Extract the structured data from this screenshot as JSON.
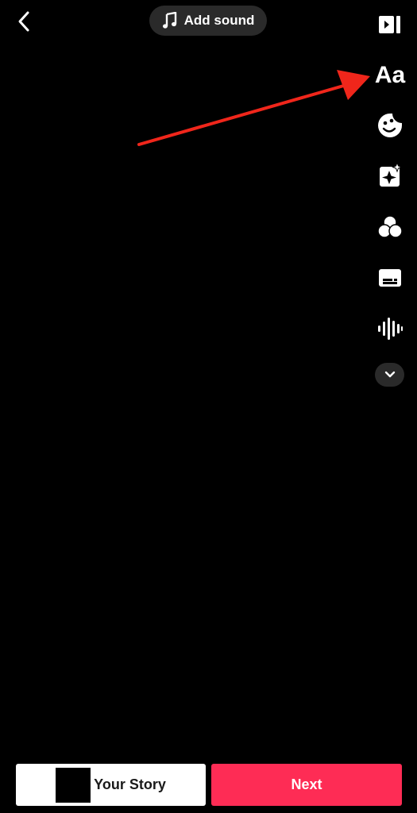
{
  "header": {
    "back_icon": "chevron-left-icon",
    "sound_icon": "music-note-icon",
    "add_sound_label": "Add sound"
  },
  "tools": {
    "items": [
      {
        "name": "flip",
        "icon": "flip-icon"
      },
      {
        "name": "text",
        "label": "Aa"
      },
      {
        "name": "stickers",
        "icon": "sticker-icon"
      },
      {
        "name": "effects",
        "icon": "effects-star-icon"
      },
      {
        "name": "filters",
        "icon": "filters-circles-icon"
      },
      {
        "name": "captions",
        "icon": "captions-icon"
      },
      {
        "name": "voice",
        "icon": "waveform-icon"
      }
    ],
    "expand_icon": "chevron-down-icon"
  },
  "annotation": {
    "color": "#f0261b"
  },
  "footer": {
    "your_story_label": "Your Story",
    "next_label": "Next",
    "next_color": "#fe2c55"
  }
}
